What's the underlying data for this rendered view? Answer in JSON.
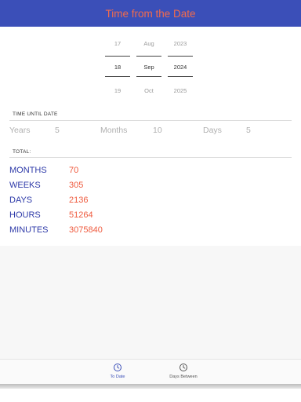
{
  "app_bar": {
    "title": "Time from the Date"
  },
  "picker": {
    "day": {
      "prev": "17",
      "current": "18",
      "next": "19"
    },
    "month": {
      "prev": "Aug",
      "current": "Sep",
      "next": "Oct"
    },
    "year": {
      "prev": "2023",
      "current": "2024",
      "next": "2025"
    }
  },
  "time_until": {
    "label": "TIME UNTIL DATE",
    "years_label": "Years",
    "years_value": "5",
    "months_label": "Months",
    "months_value": "10",
    "days_label": "Days",
    "days_value": "5"
  },
  "total": {
    "label": "TOTAL:",
    "rows": [
      {
        "key": "MONTHS",
        "value": "70"
      },
      {
        "key": "WEEKS",
        "value": "305"
      },
      {
        "key": "DAYS",
        "value": "2136"
      },
      {
        "key": "HOURS",
        "value": "51264"
      },
      {
        "key": "MINUTES",
        "value": "3075840"
      }
    ]
  },
  "bottom_nav": {
    "items": [
      {
        "label": "To Date",
        "icon": "clock-icon",
        "active": true
      },
      {
        "label": "Days Between",
        "icon": "clock-icon",
        "active": false
      }
    ]
  },
  "colors": {
    "app_bar": "#3b4fb8",
    "title": "#f26b4c",
    "key_text": "#2e3aa8",
    "value_text": "#ef5b3f",
    "nav_active": "#3b4fb8",
    "nav_inactive": "#555555"
  }
}
